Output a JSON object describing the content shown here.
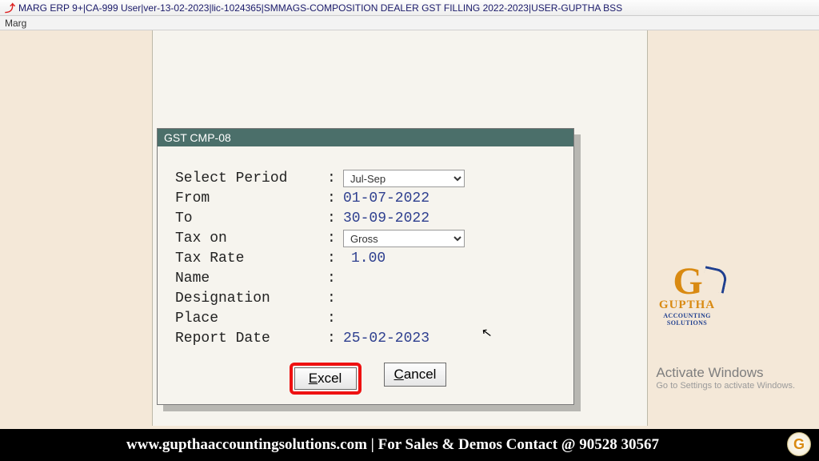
{
  "titlebar": {
    "text": "MARG ERP 9+|CA-999 User|ver-13-02-2023|lic-1024365|SMMAGS-COMPOSITION DEALER GST FILLING 2022-2023|USER-GUPTHA BSS"
  },
  "menubar": {
    "item0": "Marg"
  },
  "dialog": {
    "title": "GST CMP-08",
    "labels": {
      "select_period": "Select Period",
      "from": "From",
      "to": "To",
      "tax_on": "Tax on",
      "tax_rate": "Tax Rate",
      "name": "Name",
      "designation": "Designation",
      "place": "Place",
      "report_date": "Report Date"
    },
    "values": {
      "select_period": "Jul-Sep",
      "from": "01-07-2022",
      "to": "30-09-2022",
      "tax_on": "Gross",
      "tax_rate": "1.00",
      "name": "",
      "designation": "",
      "place": "",
      "report_date": "25-02-2023"
    },
    "buttons": {
      "excel": "Excel",
      "cancel": "Cancel"
    }
  },
  "logo": {
    "name": "GUPTHA",
    "sub": "ACCOUNTING SOLUTIONS"
  },
  "activate": {
    "line1": "Activate Windows",
    "line2": "Go to Settings to activate Windows."
  },
  "footer": {
    "text": "www.gupthaaccountingsolutions.com | For Sales & Demos Contact @ 90528 30567"
  }
}
